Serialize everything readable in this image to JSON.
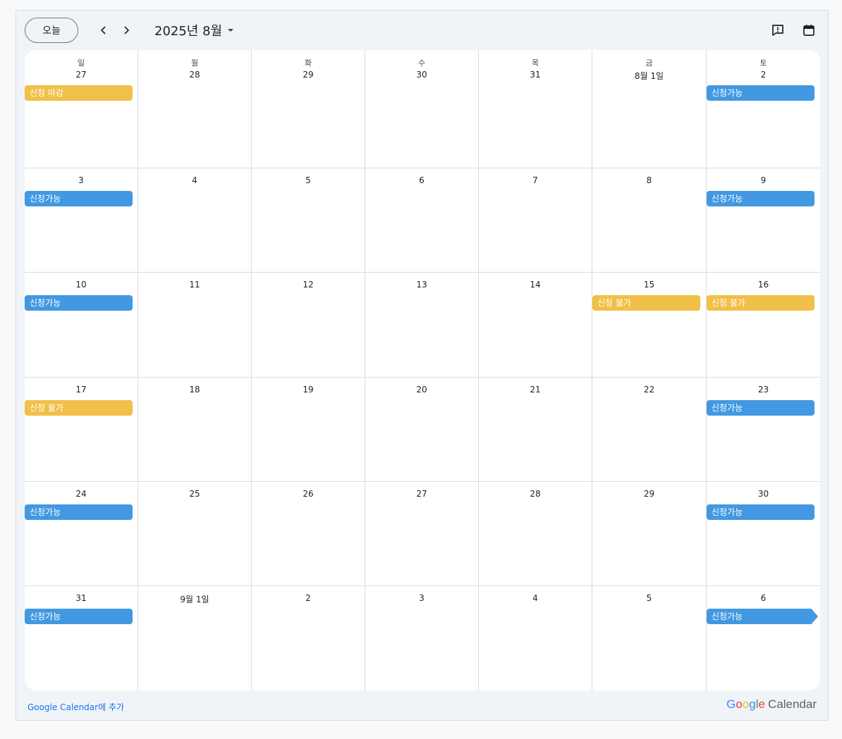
{
  "toolbar": {
    "today_label": "오늘",
    "month_title": "2025년 8월"
  },
  "colors": {
    "available": "#4299e1",
    "closed": "#f0c048"
  },
  "weekdays": [
    "일",
    "월",
    "화",
    "수",
    "목",
    "금",
    "토"
  ],
  "weeks": [
    {
      "days": [
        {
          "label": "27",
          "events": [
            {
              "text": "신청 마감",
              "type": "closed"
            }
          ]
        },
        {
          "label": "28",
          "events": []
        },
        {
          "label": "29",
          "events": []
        },
        {
          "label": "30",
          "events": []
        },
        {
          "label": "31",
          "events": []
        },
        {
          "label": "8월 1일",
          "events": []
        },
        {
          "label": "2",
          "events": [
            {
              "text": "신청가능",
              "type": "available"
            }
          ]
        }
      ]
    },
    {
      "days": [
        {
          "label": "3",
          "events": [
            {
              "text": "신청가능",
              "type": "available"
            }
          ]
        },
        {
          "label": "4",
          "events": []
        },
        {
          "label": "5",
          "events": []
        },
        {
          "label": "6",
          "events": []
        },
        {
          "label": "7",
          "events": []
        },
        {
          "label": "8",
          "events": []
        },
        {
          "label": "9",
          "events": [
            {
              "text": "신청가능",
              "type": "available"
            }
          ]
        }
      ]
    },
    {
      "days": [
        {
          "label": "10",
          "events": [
            {
              "text": "신청가능",
              "type": "available"
            }
          ]
        },
        {
          "label": "11",
          "events": []
        },
        {
          "label": "12",
          "events": []
        },
        {
          "label": "13",
          "events": []
        },
        {
          "label": "14",
          "events": []
        },
        {
          "label": "15",
          "events": [
            {
              "text": "신청 불가",
              "type": "closed"
            }
          ]
        },
        {
          "label": "16",
          "events": [
            {
              "text": "신청 불가",
              "type": "closed"
            }
          ]
        }
      ]
    },
    {
      "days": [
        {
          "label": "17",
          "events": [
            {
              "text": "신청 불가",
              "type": "closed"
            }
          ]
        },
        {
          "label": "18",
          "events": []
        },
        {
          "label": "19",
          "events": []
        },
        {
          "label": "20",
          "events": []
        },
        {
          "label": "21",
          "events": []
        },
        {
          "label": "22",
          "events": []
        },
        {
          "label": "23",
          "events": [
            {
              "text": "신청가능",
              "type": "available"
            }
          ]
        }
      ]
    },
    {
      "days": [
        {
          "label": "24",
          "events": [
            {
              "text": "신청가능",
              "type": "available"
            }
          ]
        },
        {
          "label": "25",
          "events": []
        },
        {
          "label": "26",
          "events": []
        },
        {
          "label": "27",
          "events": []
        },
        {
          "label": "28",
          "events": []
        },
        {
          "label": "29",
          "events": []
        },
        {
          "label": "30",
          "events": [
            {
              "text": "신청가능",
              "type": "available"
            }
          ]
        }
      ]
    },
    {
      "days": [
        {
          "label": "31",
          "events": [
            {
              "text": "신청가능",
              "type": "available"
            }
          ]
        },
        {
          "label": "9월 1일",
          "events": []
        },
        {
          "label": "2",
          "events": []
        },
        {
          "label": "3",
          "events": []
        },
        {
          "label": "4",
          "events": []
        },
        {
          "label": "5",
          "events": []
        },
        {
          "label": "6",
          "events": [
            {
              "text": "신청가능",
              "type": "available",
              "continues": true
            }
          ]
        }
      ]
    }
  ],
  "footer": {
    "add_link": "Google Calendar에 추가",
    "brand_google": "Google",
    "brand_calendar": "Calendar"
  },
  "icons": {
    "prev": "chevron-left-icon",
    "next": "chevron-right-icon",
    "dropdown": "caret-down-icon",
    "feedback": "feedback-icon",
    "calendar": "calendar-icon"
  }
}
